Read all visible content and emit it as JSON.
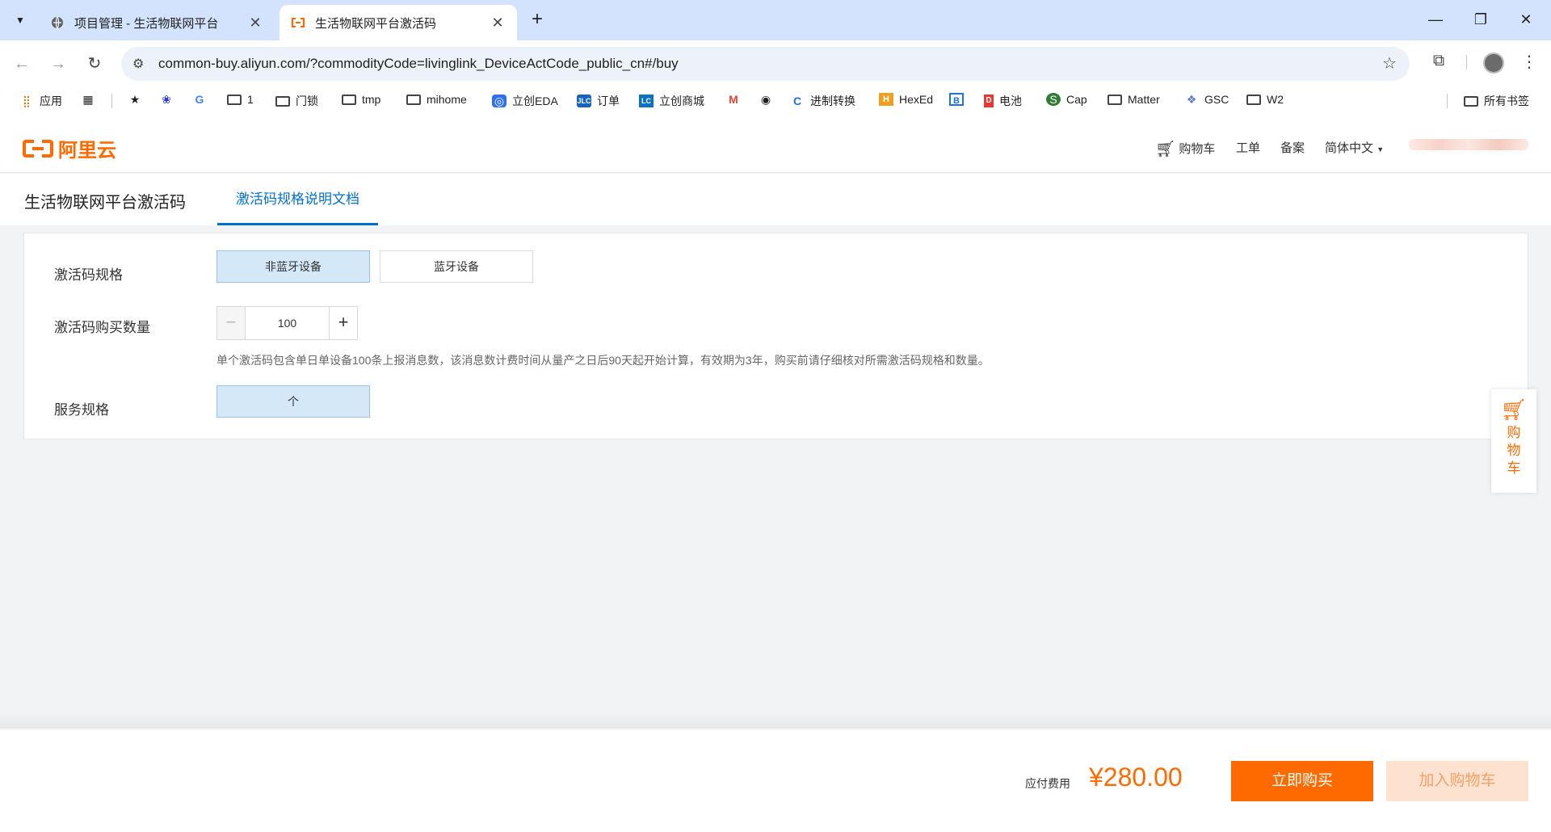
{
  "browser": {
    "tabs": [
      {
        "title": "项目管理 - 生活物联网平台",
        "active": false
      },
      {
        "title": "生活物联网平台激活码",
        "active": true
      }
    ],
    "url": "common-buy.aliyun.com/?commodityCode=livinglink_DeviceActCode_public_cn#/buy",
    "bookmarks": [
      "应用",
      "1",
      "门锁",
      "tmp",
      "mihome",
      "立创EDA",
      "订单",
      "立创商城",
      "进制转换",
      "HexEd",
      "电池",
      "Cap",
      "Matter",
      "GSC",
      "W2"
    ],
    "all_bookmarks": "所有书签"
  },
  "site": {
    "logo_text": "阿里云",
    "nav": {
      "cart": "购物车",
      "ticket": "工单",
      "filing": "备案",
      "language": "简体中文"
    }
  },
  "subnav": {
    "title": "生活物联网平台激活码",
    "doc_tab": "激活码规格说明文档"
  },
  "form": {
    "spec_label": "激活码规格",
    "spec_options": [
      "非蓝牙设备",
      "蓝牙设备"
    ],
    "spec_selected": 0,
    "qty_label": "激活码购买数量",
    "qty_value": "100",
    "qty_minus": "−",
    "qty_plus": "+",
    "note": "单个激活码包含单日单设备100条上报消息数，该消息数计费时间从量产之日后90天起开始计算，有效期为3年，购买前请仔细核对所需激活码规格和数量。",
    "service_label": "服务规格",
    "service_option": "个"
  },
  "float_cart": {
    "label": "购物车"
  },
  "footer": {
    "fee_label": "应付费用",
    "price": "¥280.00",
    "buy_now": "立即购买",
    "add_to_cart": "加入购物车"
  },
  "colors": {
    "brand": "#ff6a00",
    "link": "#0070cc",
    "selected_bg": "#d5e8f8"
  }
}
